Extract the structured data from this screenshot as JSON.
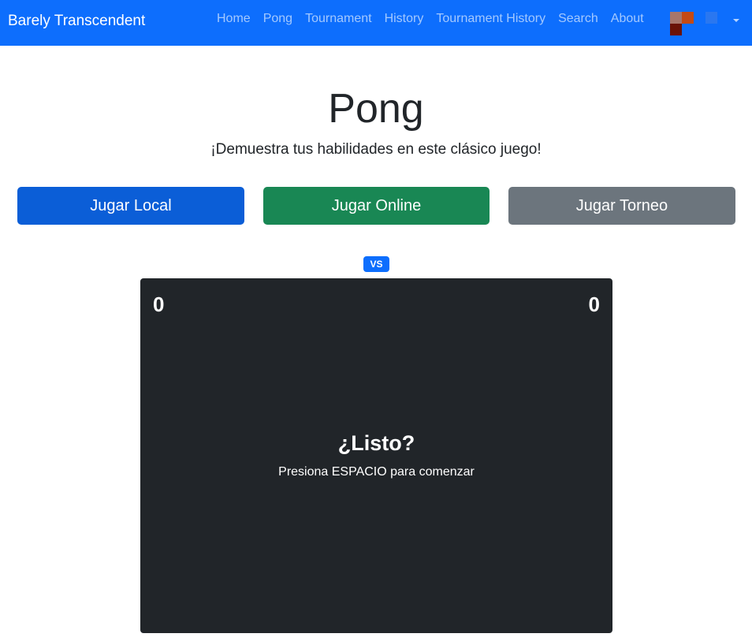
{
  "navbar": {
    "brand": "Barely Transcendent",
    "links": [
      "Home",
      "Pong",
      "Tournament",
      "History",
      "Tournament History",
      "Search",
      "About"
    ],
    "color": "#0d6efd"
  },
  "header": {
    "title": "Pong",
    "subtitle": "¡Demuestra tus habilidades en este clásico juego!"
  },
  "modes": {
    "local": "Jugar Local",
    "online": "Jugar Online",
    "tournament": "Jugar Torneo"
  },
  "game": {
    "vs_label": "VS",
    "score_left": "0",
    "score_right": "0",
    "ready_text": "¿Listo?",
    "instruction": "Presiona ESPACIO para comenzar",
    "board_color": "#212529"
  },
  "colors": {
    "primary": "#0d6efd",
    "success": "#198754",
    "secondary": "#6c757d"
  }
}
